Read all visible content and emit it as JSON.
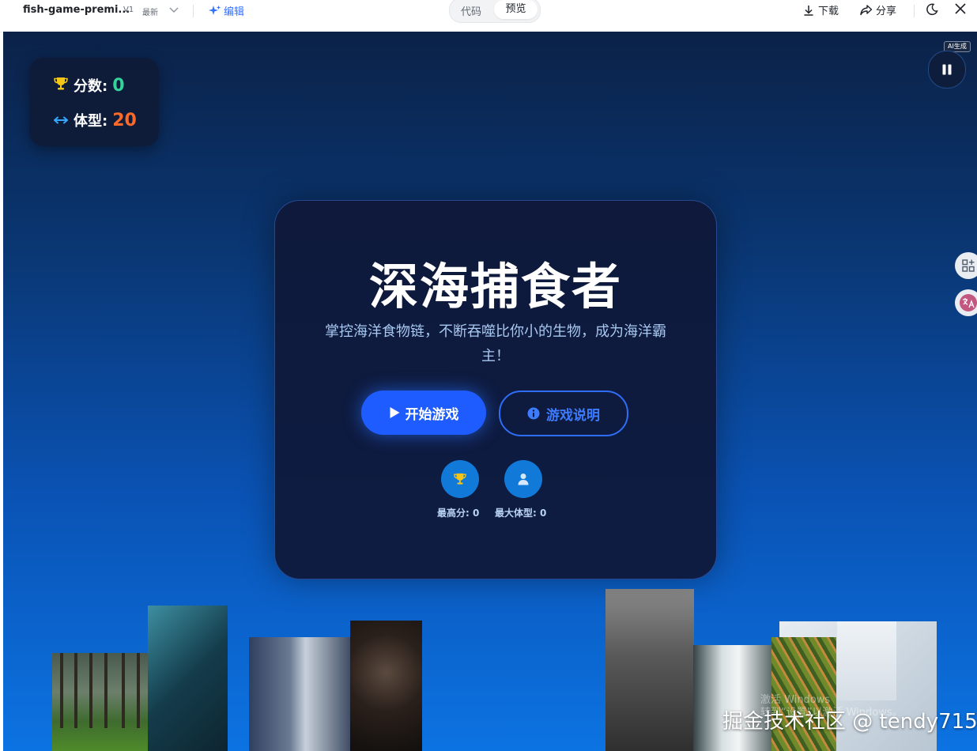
{
  "toolbar": {
    "title": "fish-game-premi...",
    "version": "V1",
    "latest": "最新",
    "edit_label": "编辑",
    "tabs": [
      "代码",
      "预览"
    ],
    "active_tab": "预览",
    "download_label": "下载",
    "share_label": "分享"
  },
  "hud": {
    "score_label": "分数:",
    "score_value": "0",
    "size_label": "体型:",
    "size_value": "20"
  },
  "badge": {
    "ai": "AI生成"
  },
  "menu": {
    "title": "深海捕食者",
    "subtitle": "掌控海洋食物链，不断吞噬比你小的生物，成为海洋霸主！",
    "start_label": "开始游戏",
    "help_label": "游戏说明",
    "best_score_label": "最高分: 0",
    "max_size_label": "最大体型: 0"
  },
  "overlay": {
    "windows_watermark": "激活 Windows\n转到“设置”以激活 Windows。",
    "site_watermark": "掘金技术社区 @ tendy715"
  },
  "icons": {
    "trophy": "trophy-icon",
    "arrows": "arrows-horizontal-icon",
    "pause": "pause-icon",
    "play": "play-icon",
    "info": "info-icon",
    "user": "user-icon"
  },
  "colors": {
    "accent": "#1e5cff",
    "score": "#34d399",
    "size": "#fb6a2b",
    "edit": "#3370ff"
  }
}
